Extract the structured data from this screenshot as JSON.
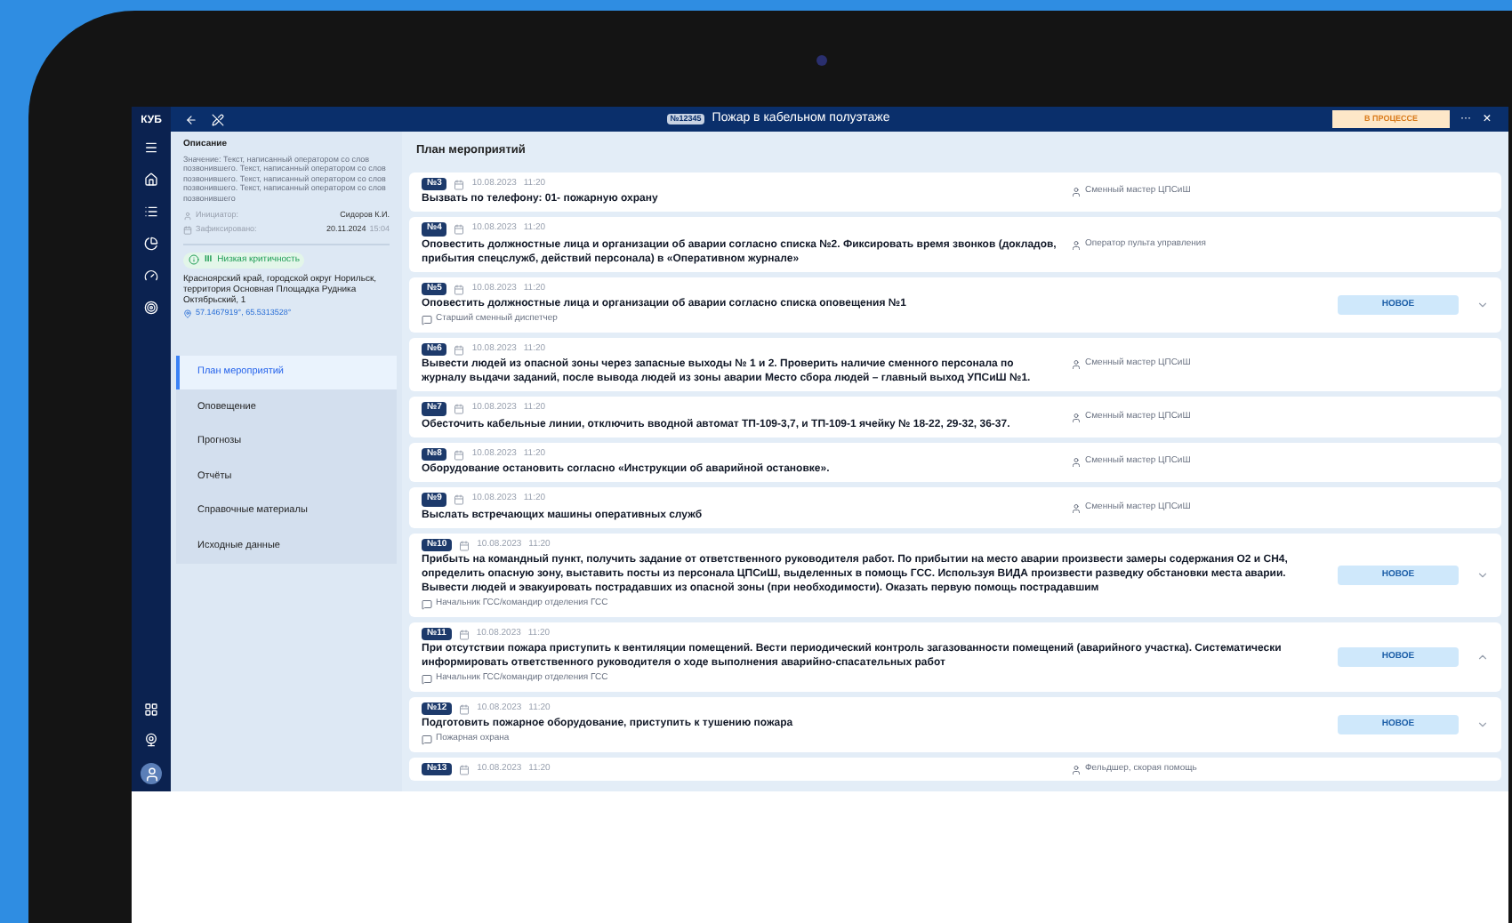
{
  "rail": {
    "logo": "КУБ"
  },
  "header": {
    "incident_number": "№12345",
    "title": "Пожар в кабельном полуэтаже",
    "status": "В ПРОЦЕССЕ",
    "more": "···",
    "close": "×"
  },
  "description": {
    "heading": "Описание",
    "text": "Значение: Текст, написанный оператором со слов позвонившего. Текст, написанный оператором со слов позвонившего. Текст, написанный оператором со слов позвонившего. Текст, написанный оператором со слов позвонившего",
    "initiator_label": "Инициатор:",
    "initiator": "Сидоров К.И.",
    "recorded_label": "Зафиксировано:",
    "recorded_date": "20.11.2024",
    "recorded_time": "15:04",
    "criticality_level": "III",
    "criticality": "Низкая критичность",
    "address": "Красноярский край, городской округ Норильск, территория Основная Площадка Рудника Октябрьский, 1",
    "coordinates": "57.1467919°, 65.5313528°"
  },
  "nav": [
    {
      "label": "План мероприятий",
      "selected": true
    },
    {
      "label": "Оповещение",
      "selected": false
    },
    {
      "label": "Прогнозы",
      "selected": false
    },
    {
      "label": "Отчёты",
      "selected": false
    },
    {
      "label": "Справочные материалы",
      "selected": false
    },
    {
      "label": "Исходные данные",
      "selected": false
    }
  ],
  "plan": {
    "title": "План мероприятий",
    "cards": [
      {
        "kind": "assignee",
        "number": "№3",
        "date": "10.08.2023",
        "time": "11:20",
        "text": "Вызвать по телефону: 01- пожарную охрану",
        "assignee": "Сменный мастер ЦПСиШ"
      },
      {
        "kind": "assignee",
        "number": "№4",
        "date": "10.08.2023",
        "time": "11:20",
        "text": "Оповестить должностные лица и организации об аварии согласно списка №2. Фиксировать время звонков (докладов, прибытия спецслужб, действий персонала) в «Оперативном журнале»",
        "assignee": "Оператор пульта управления"
      },
      {
        "kind": "status",
        "number": "№5",
        "date": "10.08.2023",
        "time": "11:20",
        "text": "Оповестить должностные лица и организации об аварии согласно списка оповещения №1",
        "responsible": "Старший сменный диспетчер",
        "status": "НОВОЕ",
        "expanded": false
      },
      {
        "kind": "assignee",
        "number": "№6",
        "date": "10.08.2023",
        "time": "11:20",
        "text": "Вывести людей из опасной зоны через запасные выходы № 1 и 2. Проверить наличие сменного персонала по журналу выдачи заданий, после вывода людей из зоны аварии Место сбора людей – главный выход УПСиШ №1.",
        "assignee": "Сменный мастер ЦПСиШ"
      },
      {
        "kind": "assignee",
        "number": "№7",
        "date": "10.08.2023",
        "time": "11:20",
        "text": "Обесточить кабельные линии, отключить вводной автомат ТП-109-3,7, и ТП-109-1 ячейку № 18-22, 29-32, 36-37.",
        "assignee": "Сменный мастер ЦПСиШ"
      },
      {
        "kind": "assignee",
        "number": "№8",
        "date": "10.08.2023",
        "time": "11:20",
        "text": "Оборудование остановить согласно «Инструкции об аварийной остановке».",
        "assignee": "Сменный мастер ЦПСиШ"
      },
      {
        "kind": "assignee",
        "number": "№9",
        "date": "10.08.2023",
        "time": "11:20",
        "text": "Выслать встречающих машины оперативных служб",
        "assignee": "Сменный мастер ЦПСиШ"
      },
      {
        "kind": "status",
        "number": "№10",
        "date": "10.08.2023",
        "time": "11:20",
        "text": "Прибыть на командный пункт, получить задание от ответственного руководителя работ. По прибытии на место аварии произвести замеры содержания О2 и СН4, определить опасную зону, выставить посты из персонала ЦПСиШ, выделенных в помощь ГСС. Используя ВИДА произвести разведку обстановки места аварии. Вывести людей и эвакуировать пострадавших из опасной зоны (при необходимости). Оказать первую помощь пострадавшим",
        "responsible": "Начальник ГСС/командир отделения ГСС",
        "status": "НОВОЕ",
        "expanded": false
      },
      {
        "kind": "status",
        "number": "№11",
        "date": "10.08.2023",
        "time": "11:20",
        "text": "При отсутствии пожара приступить к вентиляции помещений. Вести периодический контроль загазованности помещений (аварийного участка). Систематически информировать ответственного руководителя о ходе выполнения аварийно-спасательных работ",
        "responsible": "Начальник ГСС/командир отделения ГСС",
        "status": "НОВОЕ",
        "expanded": true
      },
      {
        "kind": "status",
        "number": "№12",
        "date": "10.08.2023",
        "time": "11:20",
        "text": "Подготовить пожарное оборудование, приступить к тушению пожара",
        "responsible": "Пожарная охрана",
        "status": "НОВОЕ",
        "expanded": false
      },
      {
        "kind": "assignee",
        "number": "№13",
        "date": "10.08.2023",
        "time": "11:20",
        "assignee": "Фельдшер, скорая помощь"
      }
    ]
  }
}
